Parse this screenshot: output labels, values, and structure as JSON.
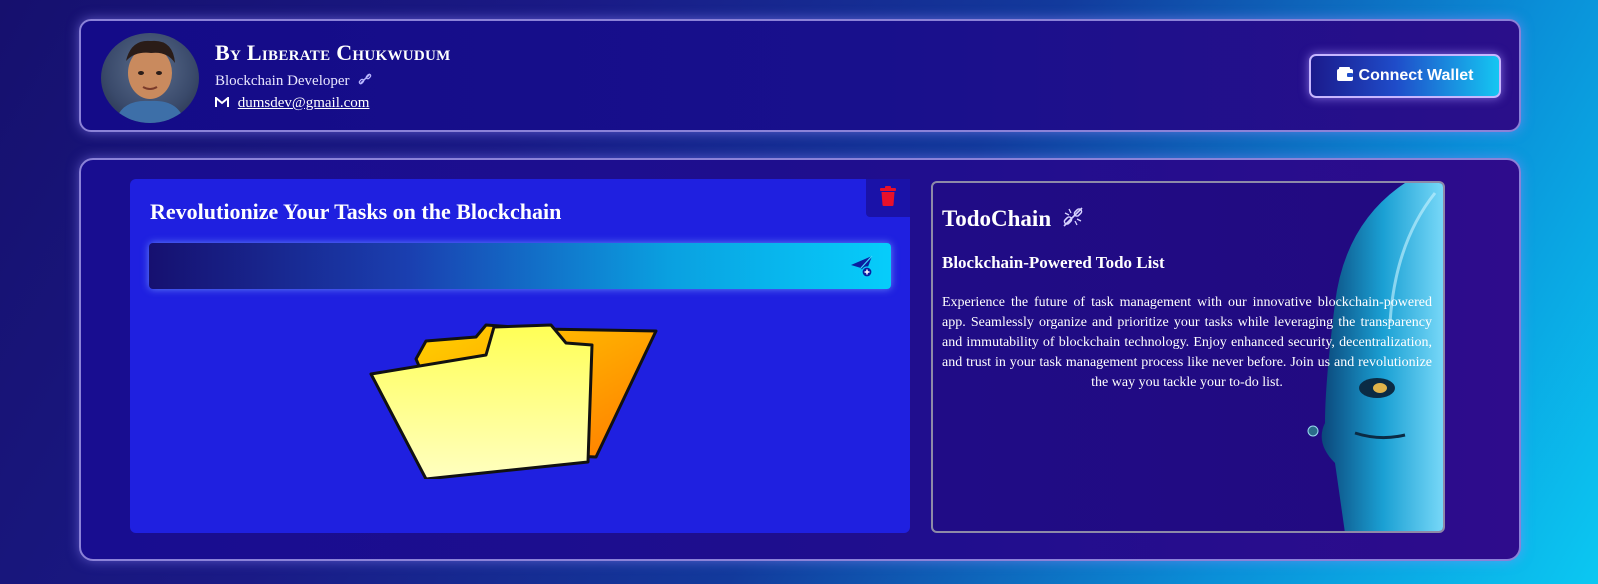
{
  "header": {
    "author_name": "By Liberate Chukwudum",
    "author_role": "Blockchain Developer",
    "author_email": "dumsdev@gmail.com",
    "connect_wallet_label": "Connect Wallet"
  },
  "icons": {
    "role": "chain-link-icon",
    "email": "gmail-icon",
    "wallet": "wallet-icon",
    "delete": "trash-icon",
    "send": "send-icon",
    "brand": "chain-link-icon"
  },
  "tasks": {
    "title": "Revolutionize Your Tasks on the Blockchain",
    "input_value": "",
    "input_placeholder": ""
  },
  "about": {
    "brand": "TodoChain",
    "subtitle": "Blockchain-Powered Todo List",
    "description": "Experience the future of task management with our innovative blockchain-powered app. Seamlessly organize and prioritize your tasks while leveraging the transparency and immutability of blockchain technology. Enjoy enhanced security, decentralization, and trust in your task management process like never before. Join us and revolutionize the way you tackle your to-do list."
  },
  "colors": {
    "panel": "#1f20e0",
    "accent_cyan": "#06cdfb",
    "delete_red": "#e8102a",
    "folder_yellow": "#ffff66"
  }
}
